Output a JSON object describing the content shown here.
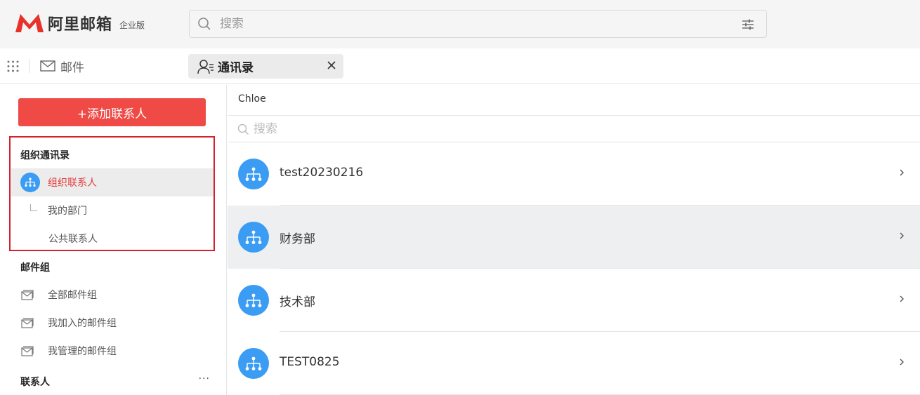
{
  "app": {
    "logo_text": "阿里邮箱",
    "logo_sub": "企业版",
    "brand_color": "#ef4a46"
  },
  "search": {
    "placeholder": "搜索"
  },
  "tabs": {
    "mail_label": "邮件",
    "contacts_label": "通讯录"
  },
  "sidebar": {
    "add_contact_label": "+添加联系人",
    "org_section_title": "组织通讯录",
    "org_items": [
      {
        "label": "组织联系人",
        "icon": "org-chart-icon",
        "active": true
      },
      {
        "label": "我的部门",
        "icon": "tree-branch-icon"
      },
      {
        "label": "公共联系人"
      }
    ],
    "mail_group_title": "邮件组",
    "mail_groups": [
      {
        "label": "全部邮件组",
        "icon": "mail-group-icon"
      },
      {
        "label": "我加入的邮件组",
        "icon": "mail-group-icon"
      },
      {
        "label": "我管理的邮件组",
        "icon": "mail-group-icon"
      }
    ],
    "contacts_title": "联系人",
    "more_label": "···"
  },
  "main": {
    "breadcrumb": "Chloe",
    "search_placeholder": "搜索",
    "departments": [
      {
        "name": "test20230216",
        "icon": "org-chart-icon"
      },
      {
        "name": "财务部",
        "icon": "org-chart-icon",
        "highlighted": true
      },
      {
        "name": "技术部",
        "icon": "org-chart-icon"
      },
      {
        "name": "TEST0825",
        "icon": "org-chart-icon"
      }
    ]
  },
  "colors": {
    "accent_blue": "#3a9cf3",
    "active_text_red": "#e33b3b",
    "highlight_box": "#d6202e"
  }
}
